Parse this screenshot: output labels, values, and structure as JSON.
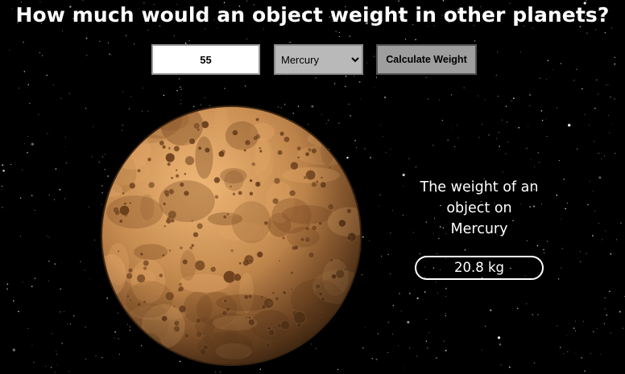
{
  "page": {
    "title": "How much would an object weight in other planets?"
  },
  "form": {
    "weight_value": "55",
    "planet_selected": "Mercury",
    "planet_options": [
      "Mercury"
    ],
    "calculate_label": "Calculate Weight"
  },
  "result": {
    "line1": "The weight of an",
    "line2": "object on",
    "planet": "Mercury",
    "value": "20.8 kg"
  },
  "planet_image": {
    "name": "Mercury",
    "colors": {
      "base": "#c08a4e",
      "light": "#e4a868",
      "dark": "#7a4a22",
      "crater": "#6b3f1c",
      "outline": "#3a2410"
    }
  },
  "colors": {
    "background": "#000000",
    "text": "#ffffff",
    "button": "#9e9e9e",
    "select": "#b9b9b9"
  }
}
